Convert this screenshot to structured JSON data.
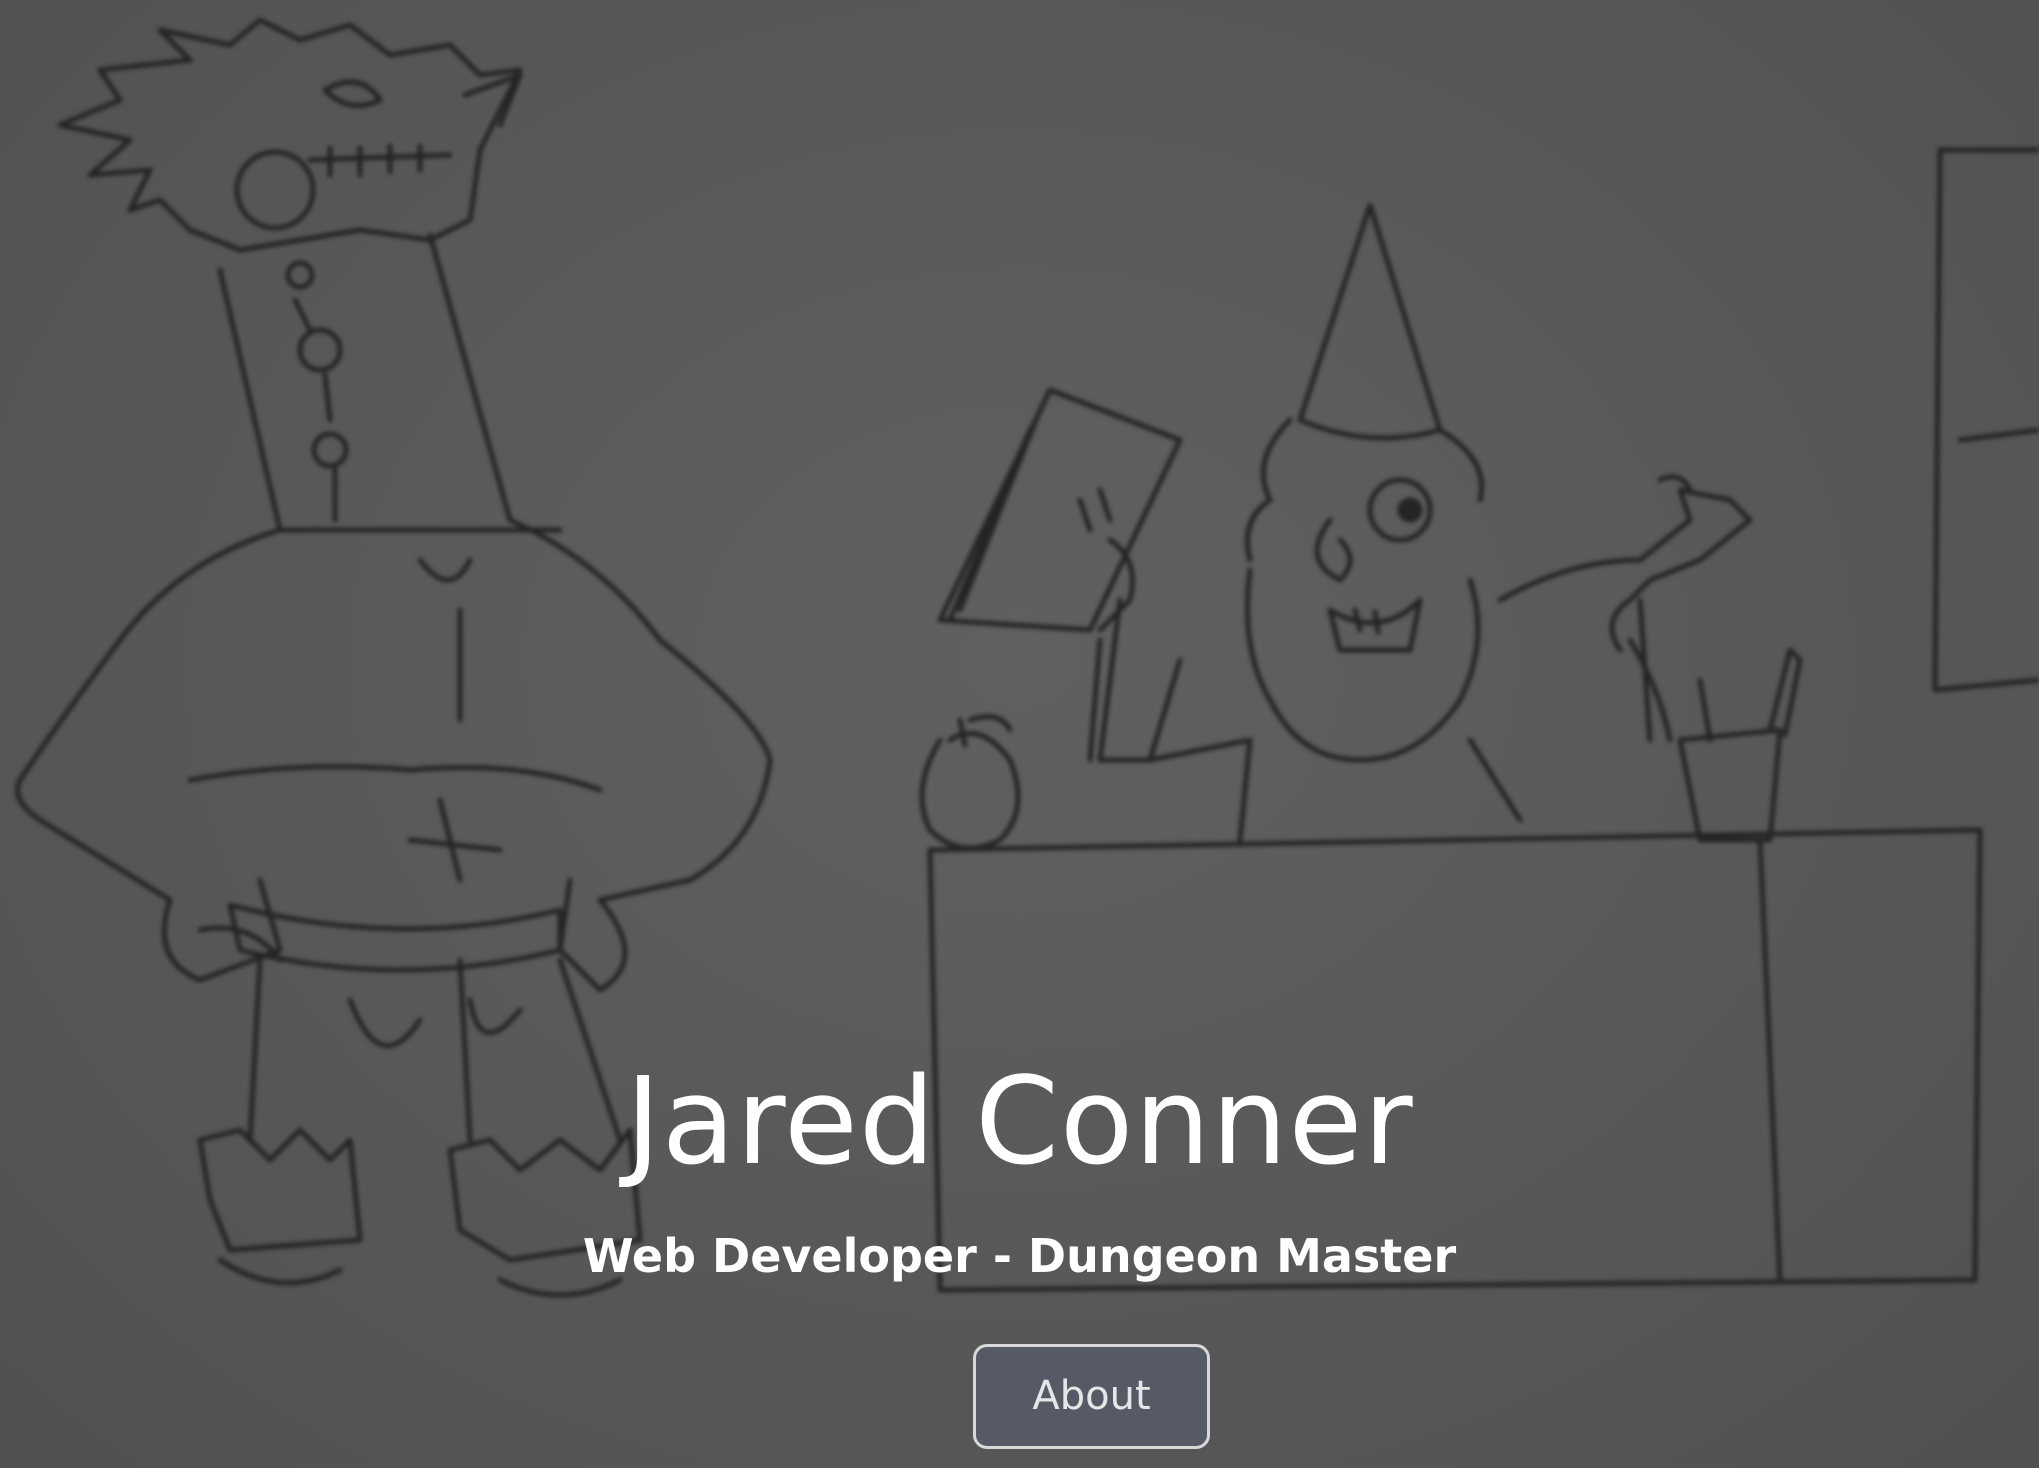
{
  "hero": {
    "name": "Jared Conner",
    "tagline": "Web Developer - Dungeon Master",
    "about_label": "About"
  },
  "colors": {
    "background": "#5a5a5a",
    "sketch_line": "#222222",
    "title_text": "#ffffff",
    "button_fill": "#555a66",
    "button_border": "#d8d8d8"
  }
}
